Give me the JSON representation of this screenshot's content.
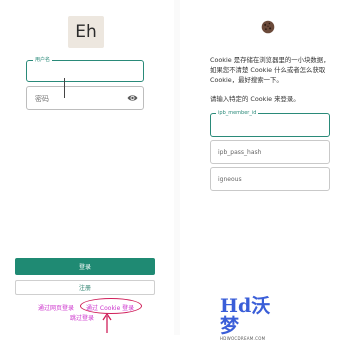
{
  "left": {
    "logo_text": "Eh",
    "username": {
      "label": "用户名",
      "value": ""
    },
    "password": {
      "placeholder": "密码",
      "icon": "eye-icon"
    },
    "login_button": "登录",
    "register_button": "注册",
    "links": {
      "web_login": "通过网页登录",
      "cookie_login": "通过 Cookie 登录",
      "skip_login": "跳过登录"
    }
  },
  "right": {
    "icon": "cookie-icon",
    "description": "Cookie 是存储在浏览器里的一小块数据，如果您不清楚 Cookie 什么或者怎么获取 Cookie，最好搜索一下。",
    "prompt": "请输入特定的 Cookie 来登录。",
    "fields": [
      {
        "label": "ipb_member_id",
        "active": true
      },
      {
        "label": "ipb_pass_hash",
        "active": false
      },
      {
        "label": "igneous",
        "active": false
      }
    ]
  },
  "watermark": {
    "big": "Hd沃梦",
    "small": "HDWOCDREAM.COM"
  },
  "colors": {
    "accent": "#1f8a73",
    "link": "#cc33cc",
    "annotation": "#d0205a"
  }
}
